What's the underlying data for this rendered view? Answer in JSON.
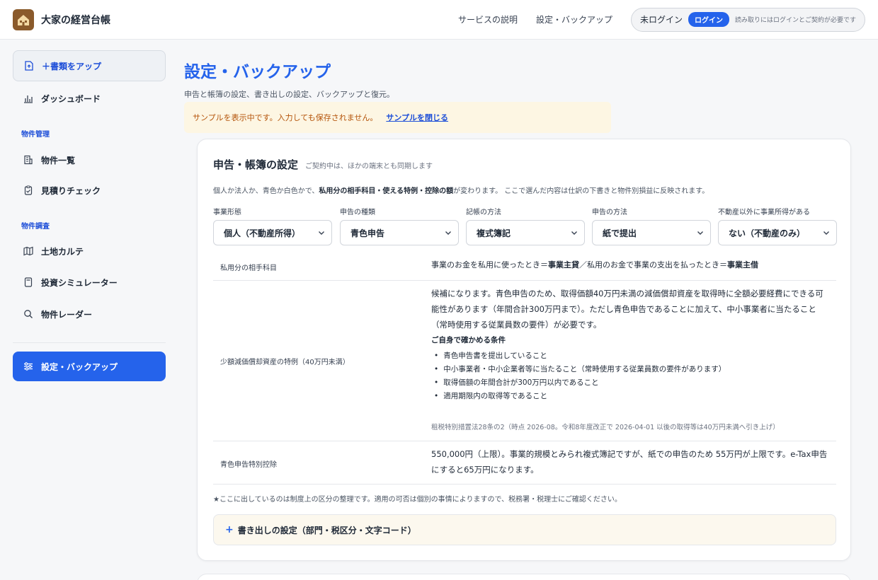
{
  "app": {
    "title": "大家の経営台帳"
  },
  "topbar": {
    "links": [
      "サービスの説明",
      "設定・バックアップ"
    ],
    "login_status": "未ログイン",
    "login_button": "ログイン",
    "login_note": "読み取りにはログインとご契約が必要です"
  },
  "sidebar": {
    "upload_button": "＋書類をアップ",
    "dashboard": "ダッシュボード",
    "section_property": "物件管理",
    "property_list": "物件一覧",
    "estimate_check": "見積りチェック",
    "section_research": "物件調査",
    "land_karte": "土地カルテ",
    "simulator": "投資シミュレーター",
    "radar": "物件レーダー",
    "settings": "設定・バックアップ",
    "accent_color": "#2563eb"
  },
  "page": {
    "title": "設定・バックアップ",
    "subtitle": "申告と帳簿の設定、書き出しの設定、バックアップと復元。",
    "notice_text": "サンプルを表示中です。入力しても保存されません。",
    "notice_link": "サンプルを閉じる"
  },
  "filing": {
    "title": "申告・帳簿の設定",
    "note": "ご契約中は、ほかの端末とも同期します",
    "desc_pre": "個人か法人か、青色か白色かで、",
    "desc_bold": "私用分の相手科目・使える特例・控除の額",
    "desc_post": "が変わります。 ここで選んだ内容は仕訳の下書きと物件別損益に反映されます。",
    "fields": [
      {
        "label": "事業形態",
        "value": "個人（不動産所得）"
      },
      {
        "label": "申告の種類",
        "value": "青色申告"
      },
      {
        "label": "記帳の方法",
        "value": "複式簿記"
      },
      {
        "label": "申告の方法",
        "value": "紙で提出"
      },
      {
        "label": "不動産以外に事業所得がある",
        "value": "ない（不動産のみ）"
      }
    ],
    "rows": {
      "private": {
        "label": "私用分の相手科目",
        "v1": "事業のお金を私用に使ったとき＝",
        "v2": "事業主貸",
        "v3": "／私用のお金で事業の支出を払ったとき＝",
        "v4": "事業主借"
      },
      "small_asset": {
        "label": "少額減価償却資産の特例（40万円未満）",
        "text": "候補になります。青色申告のため、取得価額40万円未満の減価償却資産を取得時に全額必要経費にできる可能性があります（年間合計300万円まで）。ただし青色申告であることに加えて、中小事業者に当たること（常時使用する従業員数の要件）が必要です。",
        "cond_title": "ご自身で確かめる条件",
        "conditions": [
          "青色申告書を提出していること",
          "中小事業者・中小企業者等に当たること（常時使用する従業員数の要件があります）",
          "取得価額の年間合計が300万円以内であること",
          "適用期限内の取得等であること"
        ],
        "source": "租税特別措置法28条の2（時点 2026-08。令和8年度改正で 2026-04-01 以後の取得等は40万円未満へ引き上げ）"
      },
      "blue_deduction": {
        "label": "青色申告特別控除",
        "text": "550,000円（上限）。事業的規模とみられ複式簿記ですが、紙での申告のため 55万円が上限です。e-Tax申告にすると65万円になります。"
      }
    },
    "footnote": "★ここに出しているのは制度上の区分の整理です。適用の可否は個別の事情によりますので、税務署・税理士にご確認ください。",
    "export_label": "書き出しの設定（部門・税区分・文字コード）",
    "export_plus": "+"
  }
}
